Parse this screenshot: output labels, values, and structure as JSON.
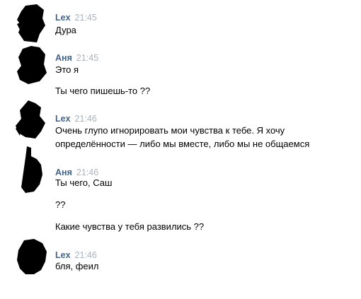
{
  "colors": {
    "author": "#42648b",
    "time": "#a8b3bf",
    "text": "#000000",
    "avatar_scribble": "#000000"
  },
  "messages": [
    {
      "author": "Lex",
      "time": "21:45",
      "avatar_icon": "scribbled-avatar-icon",
      "lines": [
        "Дура"
      ]
    },
    {
      "author": "Аня",
      "time": "21:45",
      "avatar_icon": "scribbled-avatar-icon",
      "lines": [
        "Это я",
        "Ты чего пишешь-то ??"
      ]
    },
    {
      "author": "Lex",
      "time": "21:46",
      "avatar_icon": "scribbled-avatar-icon",
      "lines": [
        "Очень глупо игнорировать мои чувства к тебе. Я хочу",
        "определённости — либо мы вместе, либо мы не общаемся"
      ]
    },
    {
      "author": "Аня",
      "time": "21:46",
      "avatar_icon": "scribbled-avatar-icon",
      "lines": [
        "Ты чего, Саш",
        "??",
        "Какие чувства у тебя развились ??"
      ]
    },
    {
      "author": "Lex",
      "time": "21:46",
      "avatar_icon": "scribbled-avatar-icon",
      "lines": [
        "бля, феил"
      ]
    }
  ]
}
